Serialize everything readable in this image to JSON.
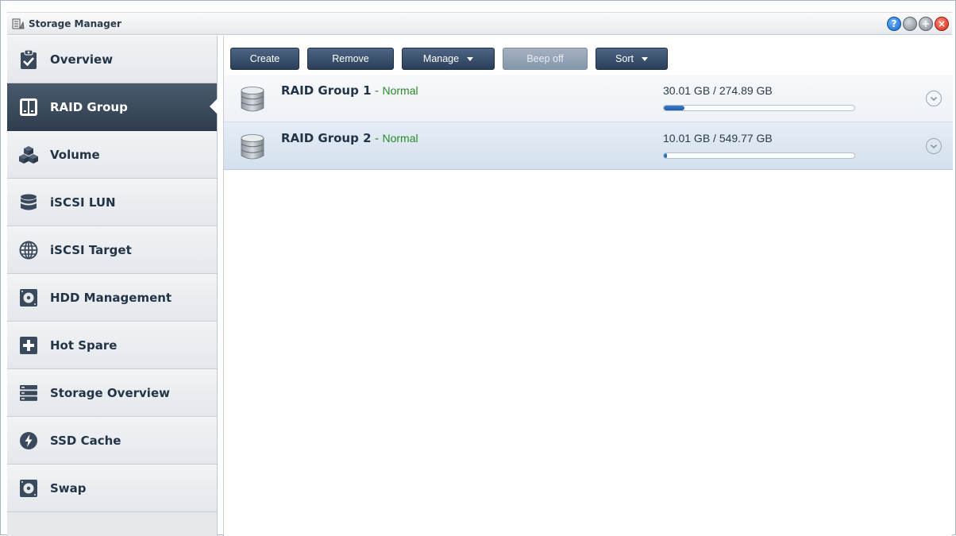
{
  "window": {
    "title": "Storage Manager"
  },
  "window_buttons": [
    "?",
    "",
    "+",
    "×"
  ],
  "sidebar": {
    "items": [
      {
        "label": "Overview",
        "icon": "clipboard-check-icon"
      },
      {
        "label": "RAID Group",
        "icon": "raid-group-icon",
        "active": true
      },
      {
        "label": "Volume",
        "icon": "cubes-icon"
      },
      {
        "label": "iSCSI LUN",
        "icon": "database-icon"
      },
      {
        "label": "iSCSI Target",
        "icon": "globe-icon"
      },
      {
        "label": "HDD Management",
        "icon": "hdd-icon"
      },
      {
        "label": "Hot Spare",
        "icon": "hot-spare-icon"
      },
      {
        "label": "Storage Overview",
        "icon": "server-rack-icon"
      },
      {
        "label": "SSD Cache",
        "icon": "lightning-icon"
      },
      {
        "label": "Swap",
        "icon": "swap-disk-icon"
      }
    ]
  },
  "toolbar": {
    "create": "Create",
    "remove": "Remove",
    "manage": "Manage",
    "beep_off": "Beep off",
    "sort": "Sort"
  },
  "raid_groups": [
    {
      "name": "RAID Group 1",
      "separator": " - ",
      "status": "Normal",
      "usage": "30.01 GB / 274.89 GB",
      "used_fraction": 0.109,
      "selected": false
    },
    {
      "name": "RAID Group 2",
      "separator": " - ",
      "status": "Normal",
      "usage": "10.01 GB / 549.77 GB",
      "used_fraction": 0.018,
      "selected": true
    }
  ],
  "colors": {
    "status_normal": "#2a8a2a",
    "active_nav": "#2f3e4f",
    "toolbar_button": "#2a3f59",
    "progress_fill": "#1f5ea8"
  }
}
